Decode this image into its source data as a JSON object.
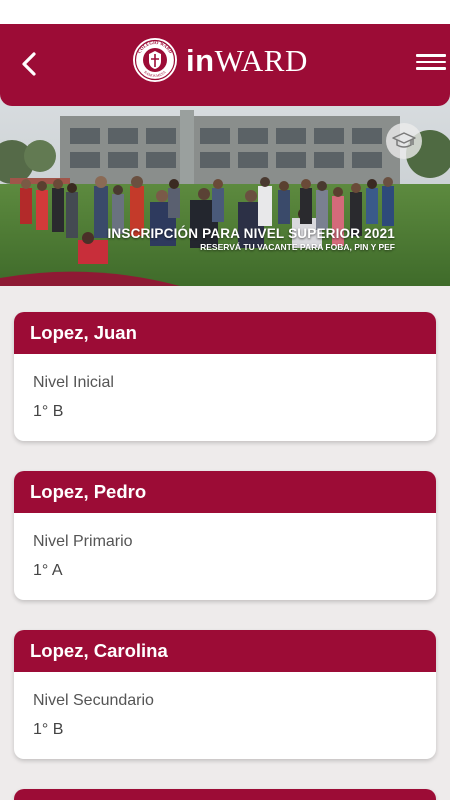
{
  "app": {
    "brand_prefix": "in",
    "brand_suffix": "WARD",
    "seal_text_top": "COLEGIO WARD",
    "seal_text_bottom": "RAMOS MEJIA",
    "accent": "#9c0c36"
  },
  "icons": {
    "back": "chevron-left-icon",
    "menu": "hamburger-menu-icon",
    "cap": "graduation-cap-icon"
  },
  "banner": {
    "title": "INSCRIPCIÓN PARA NIVEL SUPERIOR 2021",
    "subtitle": "RESERVÁ TU VACANTE PARA FOBA, PIN Y PEF"
  },
  "students": [
    {
      "name": "Lopez, Juan",
      "level": "Nivel Inicial",
      "grade": "1° B"
    },
    {
      "name": "Lopez, Pedro",
      "level": "Nivel Primario",
      "grade": "1° A"
    },
    {
      "name": "Lopez, Carolina",
      "level": "Nivel Secundario",
      "grade": "1° B"
    }
  ]
}
